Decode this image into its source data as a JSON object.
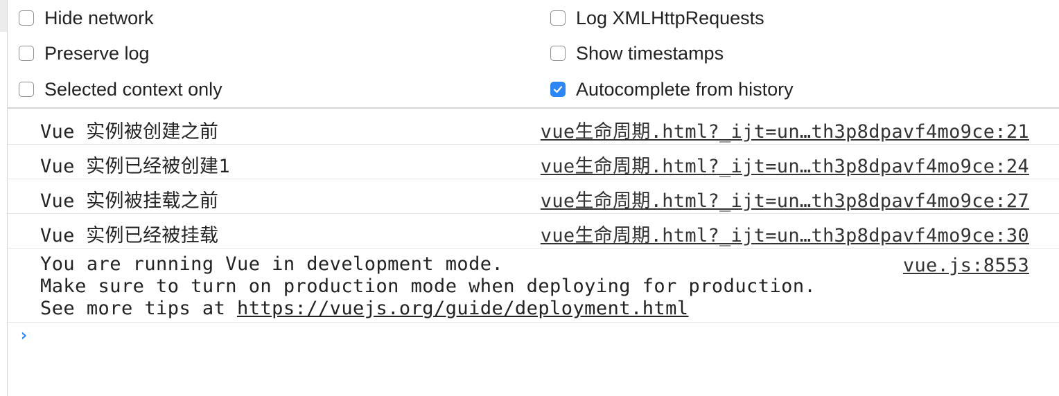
{
  "settings": {
    "hide_network": {
      "label": "Hide network",
      "checked": false
    },
    "log_xhr": {
      "label": "Log XMLHttpRequests",
      "checked": false
    },
    "preserve_log": {
      "label": "Preserve log",
      "checked": false
    },
    "show_timestamps": {
      "label": "Show timestamps",
      "checked": false
    },
    "selected_context_only": {
      "label": "Selected context only",
      "checked": false
    },
    "autocomplete_history": {
      "label": "Autocomplete from history",
      "checked": true
    }
  },
  "messages": [
    {
      "text": "Vue 实例被创建之前",
      "source": "vue生命周期.html?_ijt=un…th3p8dpavf4mo9ce:21"
    },
    {
      "text": "Vue 实例已经被创建1",
      "source": "vue生命周期.html?_ijt=un…th3p8dpavf4mo9ce:24"
    },
    {
      "text": "Vue 实例被挂载之前",
      "source": "vue生命周期.html?_ijt=un…th3p8dpavf4mo9ce:27"
    },
    {
      "text": "Vue 实例已经被挂载",
      "source": "vue生命周期.html?_ijt=un…th3p8dpavf4mo9ce:30"
    }
  ],
  "dev_message": {
    "line1": "You are running Vue in development mode.",
    "line2": "Make sure to turn on production mode when deploying for production.",
    "line3_prefix": "See more tips at ",
    "line3_link": "https://vuejs.org/guide/deployment.html",
    "source": "vue.js:8553"
  },
  "prompt": {
    "symbol": "›"
  },
  "colors": {
    "accent": "#2c86f5"
  },
  "icons": {
    "checkmark": "checkmark-icon",
    "prompt": "chevron-right-icon"
  }
}
